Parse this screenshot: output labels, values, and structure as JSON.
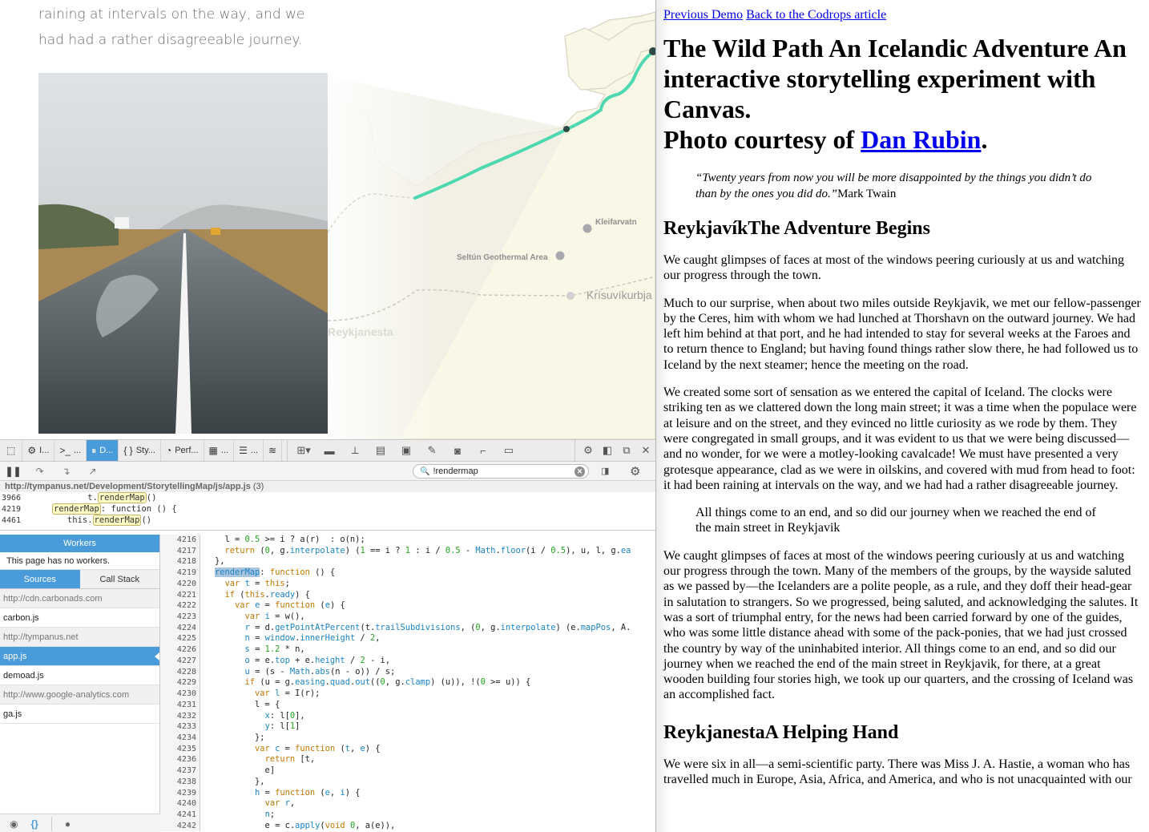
{
  "left_page": {
    "story_text": [
      "raining at intervals on the way, and we",
      "had had a rather disagreeable journey."
    ],
    "map": {
      "labels": [
        "Kleifarvatn",
        "Seltún Geothermal Area",
        "Krísuvíkurbja",
        "Reykjanesta"
      ],
      "route_color": "#4dd8b0",
      "land_color": "#f9f7e6"
    }
  },
  "document": {
    "nav_links": [
      "Previous Demo",
      "Back to the Codrops article"
    ],
    "title": "The Wild Path An Icelandic Adventure An interactive storytelling experiment with Canvas.",
    "photo_credit_prefix": "Photo courtesy of ",
    "photo_credit_link": "Dan Rubin",
    "photo_credit_suffix": ".",
    "quote_line1": "“Twenty years from now you will be more disappointed by the things you didn’t do",
    "quote_line2": "than by the ones you did do.”",
    "quote_author": "Mark Twain",
    "section1_heading": "ReykjavíkThe Adventure Begins",
    "section1_p1": "We caught glimpses of faces at most of the windows peering curiously at us and watching our progress through the town.",
    "section1_p2": "Much to our surprise, when about two miles outside Reykjavik, we met our fellow-passenger by the Ceres, him with whom we had lunched at Thorshavn on the outward journey. We had left him behind at that port, and he had intended to stay for several weeks at the Faroes and to return thence to England; but having found things rather slow there, he had followed us to Iceland by the next steamer; hence the meeting on the road.",
    "section1_p3": "We created some sort of sensation as we entered the capital of Iceland. The clocks were striking ten as we clattered down the long main street; it was a time when the populace were at leisure and on the street, and they evinced no little curiosity as we rode by them. They were congregated in small groups, and it was evident to us that we were being discussed—and no wonder, for we were a motley-looking cavalcade! We must have presented a very grotesque appearance, clad as we were in oilskins, and covered with mud from head to foot: it had been raining at intervals on the way, and we had had a rather disagreeable journey.",
    "section1_blockquote": "All things come to an end, and so did our journey when we reached the end of the main street in Reykjavik",
    "section1_p4": "We caught glimpses of faces at most of the windows peering curiously at us and watching our progress through the town. Many of the members of the groups, by the wayside saluted as we passed by—the Icelanders are a polite people, as a rule, and they doff their head-gear in salutation to strangers. So we progressed, being saluted, and acknowledging the salutes. It was a sort of triumphal entry, for the news had been carried forward by one of the guides, who was some little distance ahead with some of the pack-ponies, that we had just crossed the country by way of the uninhabited interior. All things come to an end, and so did our journey when we reached the end of the main street in Reykjavik, for there, at a great wooden building four stories high, we took up our quarters, and the crossing of Iceland was an accomplished fact.",
    "section2_heading": "ReykjanestaA Helping Hand",
    "section2_p1": "We were six in all—a semi-scientific party. There was Miss J. A. Hastie, a woman who has travelled much in Europe, Asia, Africa, and America, and who is not unacquainted with our"
  },
  "devtools": {
    "tabs": [
      {
        "label": "I...",
        "icon": "inspector-icon"
      },
      {
        "label": "...",
        "icon": "console-icon"
      },
      {
        "label": "D...",
        "icon": "debugger-icon",
        "active": true
      },
      {
        "label": "Sty...",
        "icon": "style-editor-icon"
      },
      {
        "label": "Perf...",
        "icon": "performance-icon"
      },
      {
        "label": "...",
        "icon": "memory-icon"
      },
      {
        "label": "...",
        "icon": "network-icon"
      }
    ],
    "search": {
      "value": "!rendermap",
      "placeholder": ""
    },
    "results": {
      "file": "http://tympanus.net/Development/StorytellingMap/js/app.js",
      "count": "(3)",
      "lines": [
        {
          "num": "3966",
          "before": "          t.",
          "match": "renderMap",
          "after": "()"
        },
        {
          "num": "4219",
          "before": "   ",
          "match": "renderMap",
          "after": ": function () {"
        },
        {
          "num": "4461",
          "before": "      this.",
          "match": "renderMap",
          "after": "()"
        }
      ]
    },
    "sidebar": {
      "workers_header": "Workers",
      "workers_note": "This page has no workers.",
      "tabs": [
        "Sources",
        "Call Stack"
      ],
      "sources": [
        {
          "label": "http://cdn.carbonads.com",
          "type": "domain"
        },
        {
          "label": "carbon.js",
          "type": "file"
        },
        {
          "label": "http://tympanus.net",
          "type": "domain"
        },
        {
          "label": "app.js",
          "type": "file",
          "active": true
        },
        {
          "label": "demoad.js",
          "type": "file"
        },
        {
          "label": "http://www.google-analytics.com",
          "type": "domain"
        },
        {
          "label": "ga.js",
          "type": "file"
        }
      ]
    },
    "code_lines": [
      {
        "num": "4216",
        "html": "  l = <span class=\"n\">0.5</span> &gt;= i ? a(r)  : o(n);"
      },
      {
        "num": "4217",
        "html": "  <span class=\"k\">return</span> (<span class=\"n\">0</span>, g.<span class=\"p\">interpolate</span>) (<span class=\"n\">1</span> == i ? <span class=\"n\">1</span> : i / <span class=\"n\">0.5</span> - <span class=\"p\">Math</span>.<span class=\"p\">floor</span>(i / <span class=\"n\">0.5</span>), u, l, g.<span class=\"p\">ea</span>"
      },
      {
        "num": "4218",
        "html": "},"
      },
      {
        "num": "4219",
        "html": "<span class=\"sel p\">renderMap</span>: <span class=\"k\">function</span> () {"
      },
      {
        "num": "4220",
        "html": "  <span class=\"k\">var</span> <span class=\"p\">t</span> = <span class=\"k\">this</span>;"
      },
      {
        "num": "4221",
        "html": "  <span class=\"k\">if</span> (<span class=\"k\">this</span>.<span class=\"p\">ready</span>) {"
      },
      {
        "num": "4222",
        "html": "    <span class=\"k\">var</span> <span class=\"p\">e</span> = <span class=\"k\">function</span> (<span class=\"p\">e</span>) {"
      },
      {
        "num": "4223",
        "html": "      <span class=\"k\">var</span> <span class=\"p\">i</span> = w(),"
      },
      {
        "num": "4224",
        "html": "      <span class=\"p\">r</span> = d.<span class=\"p\">getPointAtPercent</span>(t.<span class=\"p\">trailSubdivisions</span>, (<span class=\"n\">0</span>, g.<span class=\"p\">interpolate</span>) (e.<span class=\"p\">mapPos</span>, A."
      },
      {
        "num": "4225",
        "html": "      <span class=\"p\">n</span> = <span class=\"p\">window</span>.<span class=\"p\">innerHeight</span> / <span class=\"n\">2</span>,"
      },
      {
        "num": "4226",
        "html": "      <span class=\"p\">s</span> = <span class=\"n\">1.2</span> * n,"
      },
      {
        "num": "4227",
        "html": "      <span class=\"p\">o</span> = e.<span class=\"p\">top</span> + e.<span class=\"p\">height</span> / <span class=\"n\">2</span> - i,"
      },
      {
        "num": "4228",
        "html": "      <span class=\"p\">u</span> = (s - <span class=\"p\">Math</span>.<span class=\"p\">abs</span>(n - o)) / s;"
      },
      {
        "num": "4229",
        "html": "      <span class=\"k\">if</span> (u = g.<span class=\"p\">easing</span>.<span class=\"p\">quad</span>.<span class=\"p\">out</span>((<span class=\"n\">0</span>, g.<span class=\"p\">clamp</span>) (u)), !(<span class=\"n\">0</span> &gt;= u)) {"
      },
      {
        "num": "4230",
        "html": "        <span class=\"k\">var</span> <span class=\"p\">l</span> = I(r);"
      },
      {
        "num": "4231",
        "html": "        l = {"
      },
      {
        "num": "4232",
        "html": "          <span class=\"p\">x</span>: l[<span class=\"n\">0</span>],"
      },
      {
        "num": "4233",
        "html": "          <span class=\"p\">y</span>: l[<span class=\"n\">1</span>]"
      },
      {
        "num": "4234",
        "html": "        };"
      },
      {
        "num": "4235",
        "html": "        <span class=\"k\">var</span> <span class=\"p\">c</span> = <span class=\"k\">function</span> (<span class=\"p\">t</span>, <span class=\"p\">e</span>) {"
      },
      {
        "num": "4236",
        "html": "          <span class=\"k\">return</span> [t,"
      },
      {
        "num": "4237",
        "html": "          e]"
      },
      {
        "num": "4238",
        "html": "        },"
      },
      {
        "num": "4239",
        "html": "        <span class=\"p\">h</span> = <span class=\"k\">function</span> (<span class=\"p\">e</span>, <span class=\"p\">i</span>) {"
      },
      {
        "num": "4240",
        "html": "          <span class=\"k\">var</span> <span class=\"p\">r</span>,"
      },
      {
        "num": "4241",
        "html": "          <span class=\"p\">n</span>;"
      },
      {
        "num": "4242",
        "html": "          e = c.<span class=\"p\">apply</span>(<span class=\"k\">void</span> <span class=\"n\">0</span>, a(e)),"
      }
    ],
    "colors": {
      "accent": "#4a9bd9",
      "keyword": "#c27800",
      "number": "#23a521",
      "property": "#1a83c6"
    }
  }
}
